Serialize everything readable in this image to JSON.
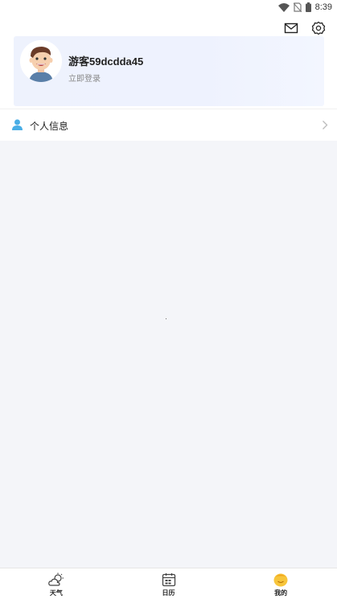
{
  "status_bar": {
    "time": "8:39",
    "icons": [
      "wifi-icon",
      "no-sim-icon",
      "battery-icon"
    ]
  },
  "header": {
    "icons": [
      "mail-icon",
      "settings-icon"
    ]
  },
  "profile": {
    "username": "游客59dcdda45",
    "login_text": "立即登录",
    "avatar_icon": "cartoon-avatar"
  },
  "menu": {
    "items": [
      {
        "label": "个人信息",
        "icon": "person-icon"
      }
    ]
  },
  "bottom_nav": {
    "items": [
      {
        "label": "天气",
        "icon": "weather-cloud-icon"
      },
      {
        "label": "日历",
        "icon": "calendar-icon"
      },
      {
        "label": "我的",
        "icon": "profile-face-icon"
      }
    ]
  },
  "colors": {
    "accent": "#4aaee6",
    "card_bg": "#eef2fd",
    "page_bg": "#f4f5f9"
  }
}
